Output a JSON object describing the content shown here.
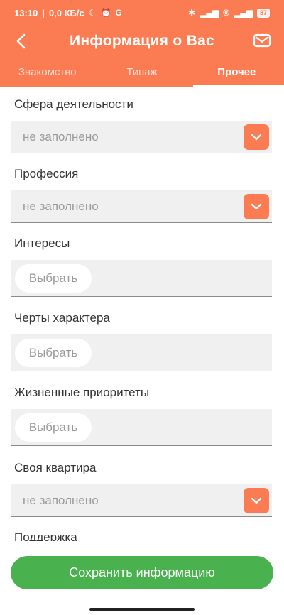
{
  "status_bar": {
    "time": "13:10",
    "network_speed": "0,0 КБ/с",
    "battery": "87"
  },
  "header": {
    "title": "Информация о Вас"
  },
  "tabs": [
    {
      "label": "Знакомство",
      "active": false
    },
    {
      "label": "Типаж",
      "active": false
    },
    {
      "label": "Прочее",
      "active": true
    }
  ],
  "fields": {
    "sphere": {
      "label": "Сфера деятельности",
      "value": "не заполнено"
    },
    "profession": {
      "label": "Профессия",
      "value": "не заполнено"
    },
    "interests": {
      "label": "Интересы",
      "button": "Выбрать"
    },
    "character": {
      "label": "Черты характера",
      "button": "Выбрать"
    },
    "priorities": {
      "label": "Жизненные приоритеты",
      "button": "Выбрать"
    },
    "apartment": {
      "label": "Своя квартира",
      "value": "не заполнено"
    },
    "support": {
      "label": "Поддержка"
    }
  },
  "save_button": {
    "label": "Сохранить информацию"
  },
  "colors": {
    "accent": "#fb7c52",
    "save": "#49b14e",
    "field_bg": "#f0f0f0"
  }
}
